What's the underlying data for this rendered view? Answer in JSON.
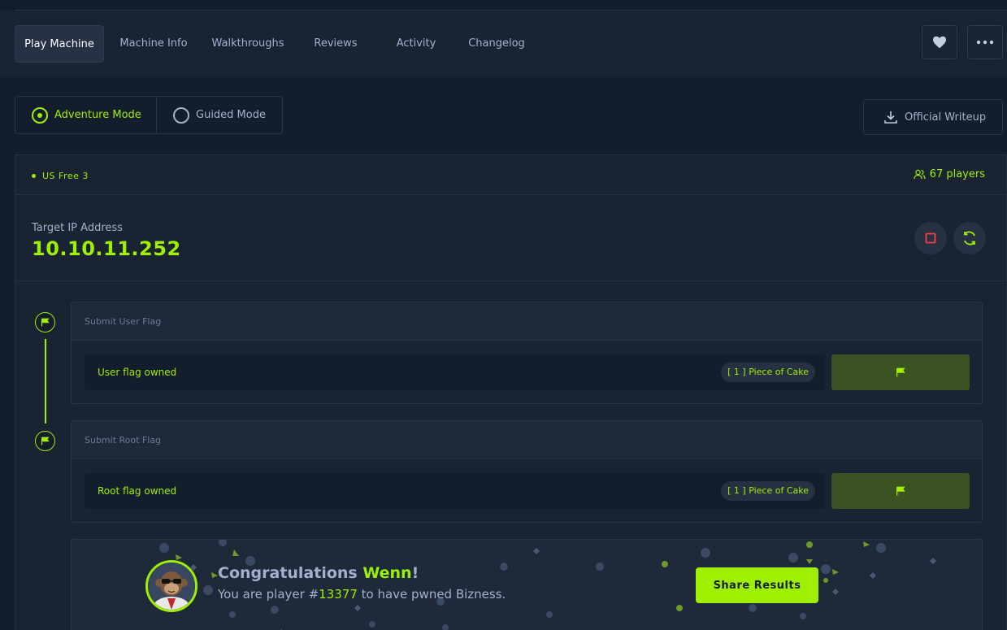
{
  "tabs": [
    {
      "label": "Play Machine",
      "active": true
    },
    {
      "label": "Machine Info",
      "active": false
    },
    {
      "label": "Walkthroughs",
      "active": false
    },
    {
      "label": "Reviews",
      "active": false
    },
    {
      "label": "Activity",
      "active": false
    },
    {
      "label": "Changelog",
      "active": false
    }
  ],
  "actions": {
    "favorite_icon": "heart-icon",
    "more_icon": "ellipsis-icon"
  },
  "modes": {
    "adventure": "Adventure Mode",
    "guided": "Guided Mode",
    "selected": "adventure"
  },
  "writeup": {
    "label": "Official Writeup",
    "icon": "download-icon"
  },
  "server": {
    "name": "US Free 3",
    "players": "67 players"
  },
  "target": {
    "label": "Target IP Address",
    "ip": "10.10.11.252"
  },
  "user_flag": {
    "title": "Submit User Flag",
    "status": "User flag owned",
    "difficulty": "[ 1 ] Piece of Cake"
  },
  "root_flag": {
    "title": "Submit Root Flag",
    "status": "Root flag owned",
    "difficulty": "[ 1 ] Piece of Cake"
  },
  "congrats": {
    "prefix": "Congratulations ",
    "name": "Wenn",
    "suffix": "!",
    "sub_prefix": "You are player #",
    "player_number": "13377",
    "sub_suffix": " to have pwned Bizness.",
    "share_label": "Share Results"
  },
  "colors": {
    "accent": "#9fef00",
    "background": "#141d2b",
    "panel": "#1a2332",
    "text": "#a4b1cd"
  }
}
